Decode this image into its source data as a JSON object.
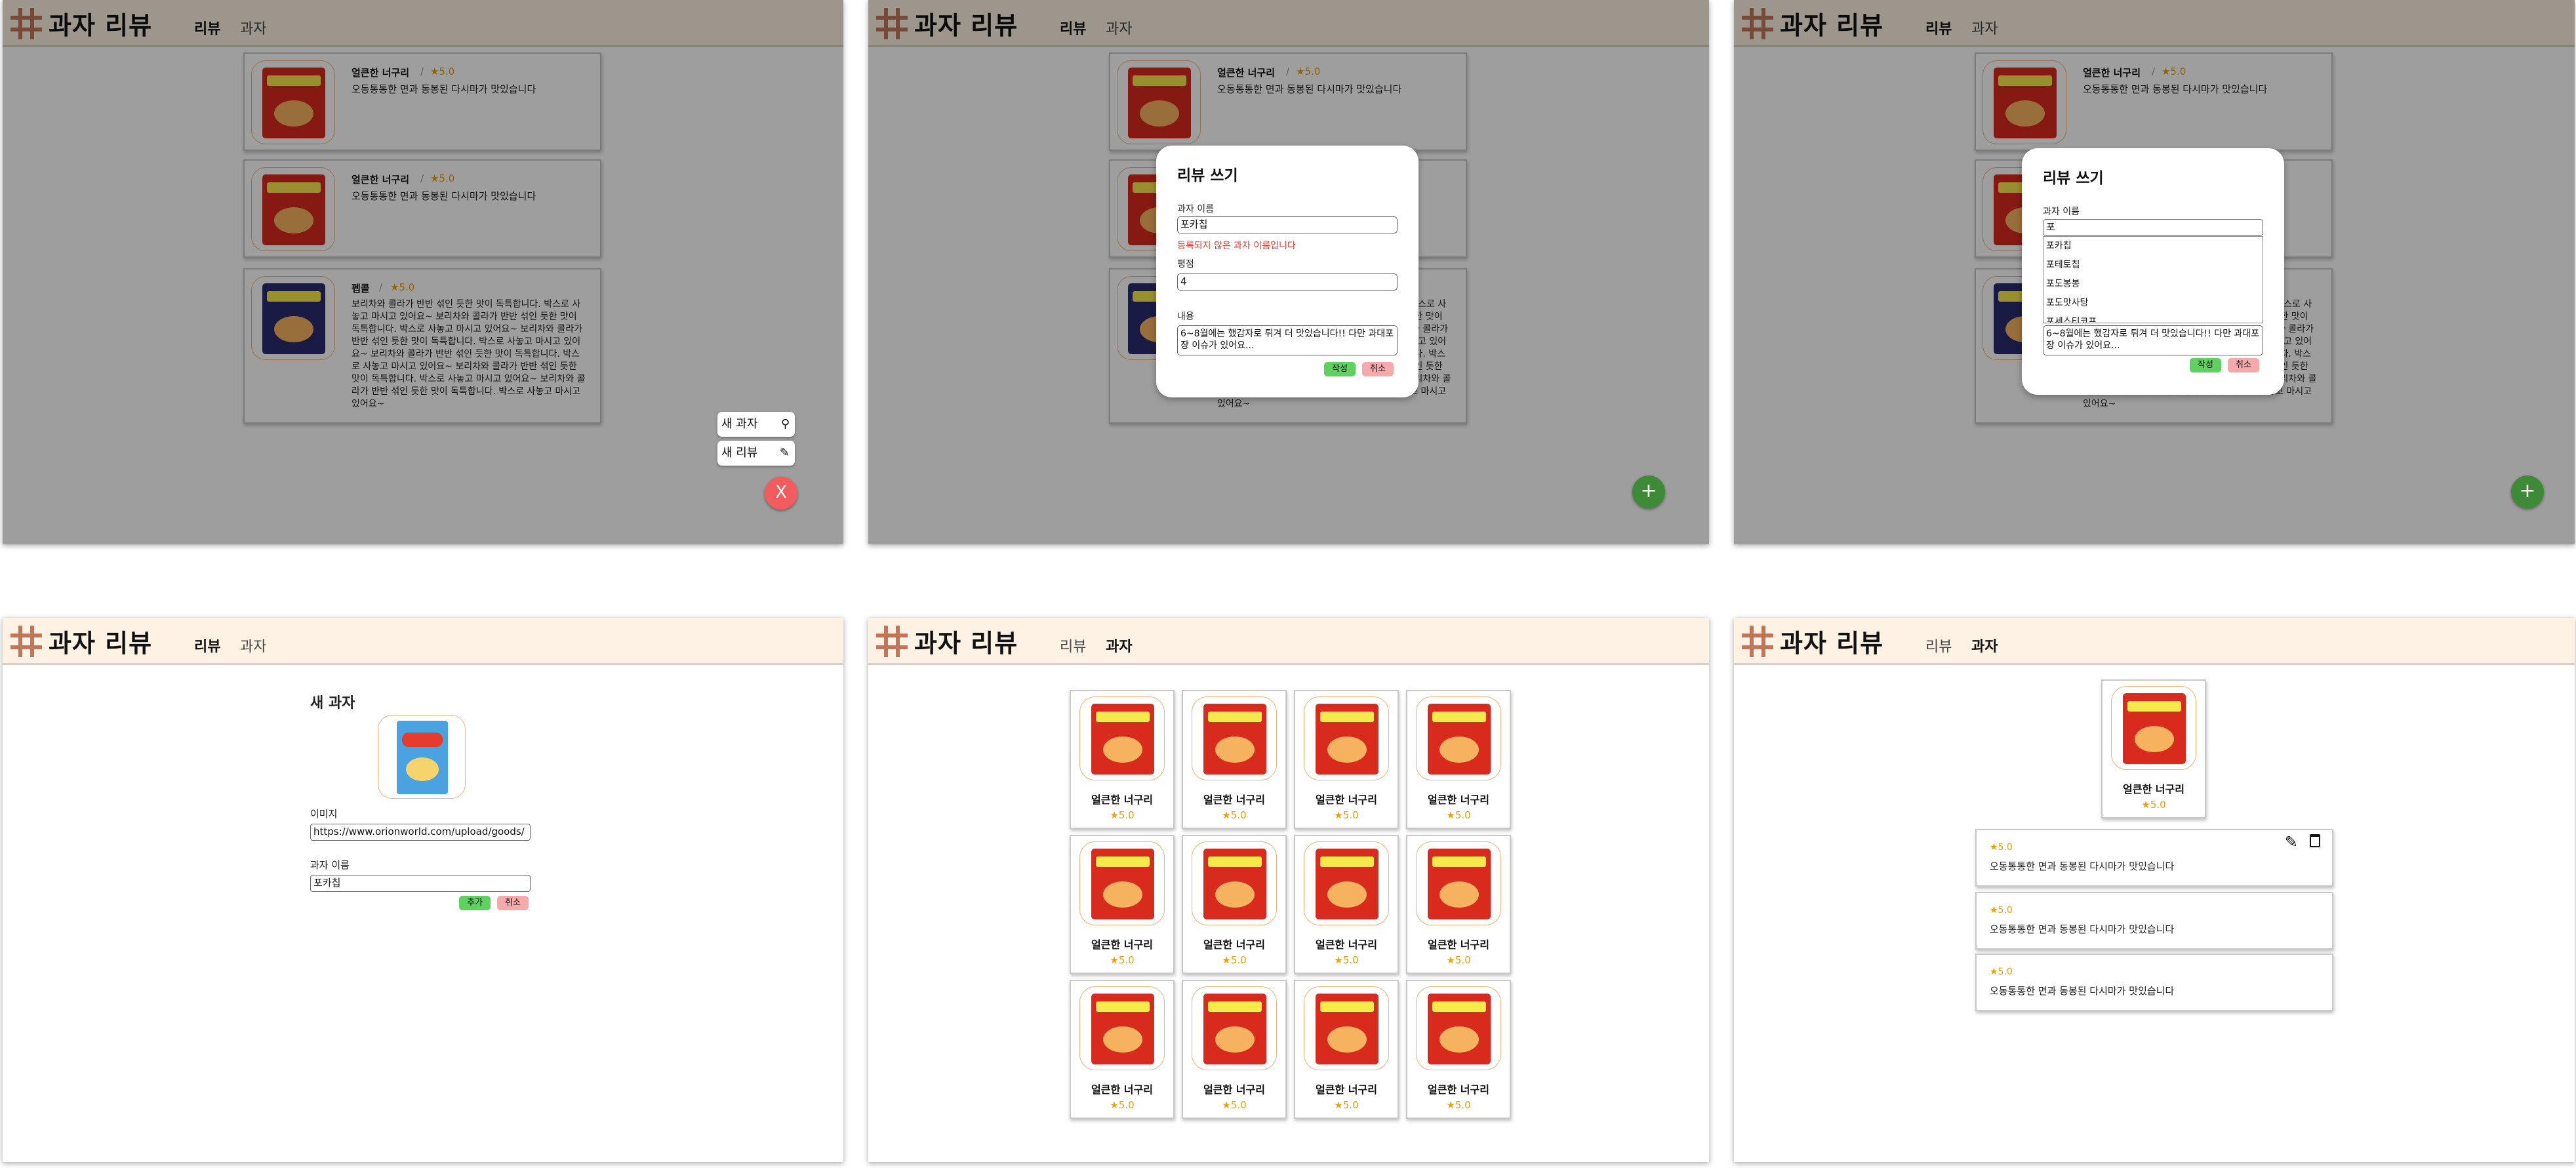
{
  "app": {
    "title": "과자 리뷰",
    "nav_review": "리뷰",
    "nav_snack": "과자"
  },
  "colors": {
    "header_bg": "#fdf2e3",
    "star": "#f0a000",
    "fab_green": "#3d8b37",
    "fab_red": "#f25c5f",
    "error": "#e53935",
    "ok_button": "#5fd160",
    "cancel_button": "#f5a9ab"
  },
  "reviews": [
    {
      "name": "얼큰한 너구리",
      "sep": "/",
      "rating": "★5.0",
      "text": "오동통통한 면과 동봉된 다시마가 맛있습니다"
    },
    {
      "name": "얼큰한 너구리",
      "sep": "/",
      "rating": "★5.0",
      "text": "오동통통한 면과 동봉된 다시마가 맛있습니다"
    },
    {
      "name": "펩콜",
      "sep": "/",
      "rating": "★5.0",
      "text": "보리차와 콜라가 반반 섞인 듯한 맛이 독특합니다. 박스로 사놓고 마시고 있어요~ 보리차와 콜라가 반반 섞인 듯한 맛이 독특합니다. 박스로 사놓고 마시고 있어요~ 보리차와 콜라가 반반 섞인 듯한 맛이 독특합니다. 박스로 사놓고 마시고 있어요~ 보리차와 콜라가 반반 섞인 듯한 맛이 독특합니다. 박스로 사놓고 마시고 있어요~ 보리차와 콜라가 반반 섞인 듯한 맛이 독특합니다. 박스로 사놓고 마시고 있어요~ 보리차와 콜라가 반반 섞인 듯한 맛이 독특합니다. 박스로 사놓고 마시고 있어요~"
    }
  ],
  "fab_menu": {
    "new_snack": "새 과자",
    "new_review": "새 리뷰",
    "close": "X",
    "add": "+"
  },
  "review_modal": {
    "title": "리뷰 쓰기",
    "snack_name_label": "과자 이름",
    "snack_name_value": "포카칩",
    "error": "등록되지 않은 과자 이름입니다",
    "rating_label": "평점",
    "rating_value": "4",
    "content_label": "내용",
    "content_value": "6~8월에는 했감자로 튀겨 더 맛있습니다!! 다만 과대포장 이슈가 있어요...",
    "submit": "작성",
    "cancel": "취소"
  },
  "autocomplete": {
    "query": "포",
    "options": [
      "포카칩",
      "포테토칩",
      "포도봉봉",
      "포도맛사탕",
      "포세스티코프"
    ]
  },
  "new_snack": {
    "title": "새 과자",
    "image_label": "이미지",
    "image_value": "https://www.orionworld.com/upload/goods/",
    "name_label": "과자 이름",
    "name_value": "포카칩",
    "add": "추가",
    "cancel": "취소"
  },
  "snack_grid": [
    {
      "name": "얼큰한 너구리",
      "rating": "★5.0"
    },
    {
      "name": "얼큰한 너구리",
      "rating": "★5.0"
    },
    {
      "name": "얼큰한 너구리",
      "rating": "★5.0"
    },
    {
      "name": "얼큰한 너구리",
      "rating": "★5.0"
    },
    {
      "name": "얼큰한 너구리",
      "rating": "★5.0"
    },
    {
      "name": "얼큰한 너구리",
      "rating": "★5.0"
    },
    {
      "name": "얼큰한 너구리",
      "rating": "★5.0"
    },
    {
      "name": "얼큰한 너구리",
      "rating": "★5.0"
    },
    {
      "name": "얼큰한 너구리",
      "rating": "★5.0"
    },
    {
      "name": "얼큰한 너구리",
      "rating": "★5.0"
    },
    {
      "name": "얼큰한 너구리",
      "rating": "★5.0"
    },
    {
      "name": "얼큰한 너구리",
      "rating": "★5.0"
    }
  ],
  "snack_detail": {
    "name": "얼큰한 너구리",
    "rating": "★5.0",
    "reviews": [
      {
        "rating": "★5.0",
        "text": "오동통통한 면과 동봉된 다시마가 맛있습니다"
      },
      {
        "rating": "★5.0",
        "text": "오동통통한 면과 동봉된 다시마가 맛있습니다"
      },
      {
        "rating": "★5.0",
        "text": "오동통통한 면과 동봉된 다시마가 맛있습니다"
      }
    ]
  }
}
